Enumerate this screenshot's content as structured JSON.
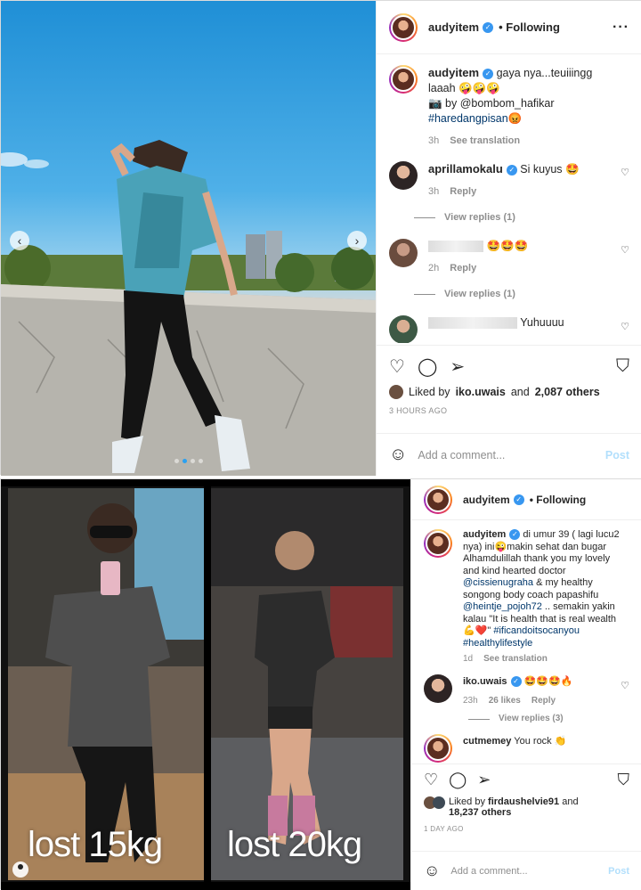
{
  "post1": {
    "username": "audyitem",
    "follow_label": "Following",
    "more_icon": "more-icon",
    "caption": "gaya nya...teuiiingg laaah 🤪🤪🤪",
    "caption_line2": "📷 by @bombom_hafikar",
    "hashtag": "#haredangpisan😡",
    "caption_time": "3h",
    "see_translation": "See translation",
    "comments": [
      {
        "user": "aprillamokalu",
        "text": "Si kuyus 🤩",
        "time": "3h",
        "reply": "Reply",
        "view": "View replies (1)"
      },
      {
        "user": "",
        "text": "🤩🤩🤩",
        "time": "2h",
        "reply": "Reply",
        "view": "View replies (1)"
      },
      {
        "user": "",
        "text": "Yuhuuuu",
        "time": "",
        "reply": "",
        "view": ""
      }
    ],
    "liked_by_prefix": "Liked by",
    "liked_by_user": "iko.uwais",
    "liked_by_and": "and",
    "liked_by_count": "2,087 others",
    "ago": "3 HOURS AGO",
    "add_comment_placeholder": "Add a comment...",
    "post_label": "Post"
  },
  "post2": {
    "username": "audyitem",
    "follow_label": "Following",
    "caption": "di umur 39 ( lagi lucu2 nya) ini😜makin sehat dan bugar Alhamdulillah thank you my lovely and kind hearted doctor",
    "mention1": "@cissienugraha",
    "caption_mid": "& my healthy songong body coach papashifu",
    "mention2": "@heintje_pojoh72",
    "caption_end": ".. semakin yakin kalau \"It is health that is real wealth 💪❤️\"",
    "hashtag1": "#ificandoitsocanyou",
    "hashtag2": "#healthylifestyle",
    "caption_time": "1d",
    "see_translation": "See translation",
    "comments": [
      {
        "user": "iko.uwais",
        "text": "🤩🤩🤩🔥",
        "time": "23h",
        "likes": "26 likes",
        "reply": "Reply",
        "view": "View replies (3)"
      },
      {
        "user": "cutmemey",
        "text": "You rock 👏"
      }
    ],
    "liked_by_prefix": "Liked by",
    "liked_by_user": "firdaushelvie91",
    "liked_by_and": "and",
    "liked_by_count": "18,237 others",
    "ago": "1 DAY AGO",
    "add_comment_placeholder": "Add a comment...",
    "post_label": "Post",
    "photo_left_label": "lost 15kg",
    "photo_right_label": "lost 20kg"
  }
}
